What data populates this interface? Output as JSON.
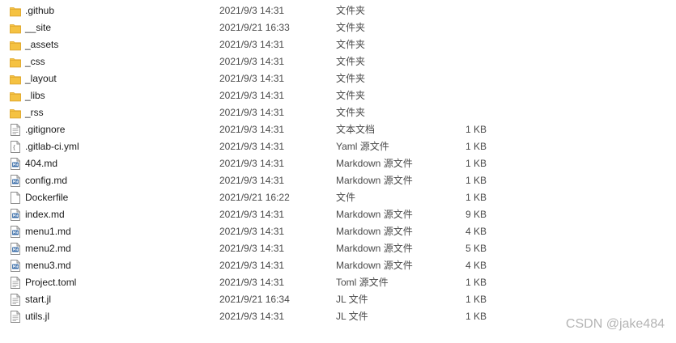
{
  "files": [
    {
      "name": ".github",
      "date": "2021/9/3 14:31",
      "type": "文件夹",
      "size": "",
      "icon": "folder-icon"
    },
    {
      "name": "__site",
      "date": "2021/9/21 16:33",
      "type": "文件夹",
      "size": "",
      "icon": "folder-icon"
    },
    {
      "name": "_assets",
      "date": "2021/9/3 14:31",
      "type": "文件夹",
      "size": "",
      "icon": "folder-icon"
    },
    {
      "name": "_css",
      "date": "2021/9/3 14:31",
      "type": "文件夹",
      "size": "",
      "icon": "folder-icon"
    },
    {
      "name": "_layout",
      "date": "2021/9/3 14:31",
      "type": "文件夹",
      "size": "",
      "icon": "folder-icon"
    },
    {
      "name": "_libs",
      "date": "2021/9/3 14:31",
      "type": "文件夹",
      "size": "",
      "icon": "folder-icon"
    },
    {
      "name": "_rss",
      "date": "2021/9/3 14:31",
      "type": "文件夹",
      "size": "",
      "icon": "folder-icon"
    },
    {
      "name": ".gitignore",
      "date": "2021/9/3 14:31",
      "type": "文本文档",
      "size": "1 KB",
      "icon": "text-file-icon"
    },
    {
      "name": ".gitlab-ci.yml",
      "date": "2021/9/3 14:31",
      "type": "Yaml 源文件",
      "size": "1 KB",
      "icon": "script-file-icon"
    },
    {
      "name": "404.md",
      "date": "2021/9/3 14:31",
      "type": "Markdown 源文件",
      "size": "1 KB",
      "icon": "markdown-file-icon"
    },
    {
      "name": "config.md",
      "date": "2021/9/3 14:31",
      "type": "Markdown 源文件",
      "size": "1 KB",
      "icon": "markdown-file-icon"
    },
    {
      "name": "Dockerfile",
      "date": "2021/9/21 16:22",
      "type": "文件",
      "size": "1 KB",
      "icon": "blank-file-icon"
    },
    {
      "name": "index.md",
      "date": "2021/9/3 14:31",
      "type": "Markdown 源文件",
      "size": "9 KB",
      "icon": "markdown-file-icon"
    },
    {
      "name": "menu1.md",
      "date": "2021/9/3 14:31",
      "type": "Markdown 源文件",
      "size": "4 KB",
      "icon": "markdown-file-icon"
    },
    {
      "name": "menu2.md",
      "date": "2021/9/3 14:31",
      "type": "Markdown 源文件",
      "size": "5 KB",
      "icon": "markdown-file-icon"
    },
    {
      "name": "menu3.md",
      "date": "2021/9/3 14:31",
      "type": "Markdown 源文件",
      "size": "4 KB",
      "icon": "markdown-file-icon"
    },
    {
      "name": "Project.toml",
      "date": "2021/9/3 14:31",
      "type": "Toml 源文件",
      "size": "1 KB",
      "icon": "text-file-icon"
    },
    {
      "name": "start.jl",
      "date": "2021/9/21 16:34",
      "type": "JL 文件",
      "size": "1 KB",
      "icon": "text-file-icon"
    },
    {
      "name": "utils.jl",
      "date": "2021/9/3 14:31",
      "type": "JL 文件",
      "size": "1 KB",
      "icon": "text-file-icon"
    }
  ],
  "watermark": "CSDN @jake484",
  "colors": {
    "folder": "#f5c242",
    "folder_dark": "#e0a82e",
    "markdown_badge": "#3b6ea8"
  }
}
